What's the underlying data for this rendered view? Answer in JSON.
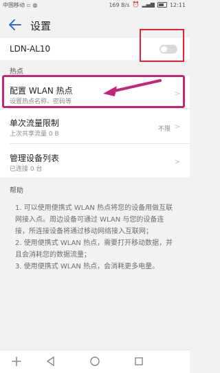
{
  "statusbar": {
    "carrier": "中国移动",
    "speed": "169 B/s",
    "battery": "33",
    "time": "12:11"
  },
  "header": {
    "title": "设置"
  },
  "device": {
    "name": "LDN-AL10",
    "toggle_on": false
  },
  "sections": {
    "hotspot_label": "热点",
    "help_label": "帮助"
  },
  "items": [
    {
      "title": "配置 WLAN 热点",
      "subtitle": "设置热点名称、密码等"
    },
    {
      "title": "单次流量限制",
      "subtitle": "上次共享流量 0 B",
      "value": "不限"
    },
    {
      "title": "管理设备列表",
      "subtitle": "已连接 0 台"
    }
  ],
  "help_text": [
    "1. 可以使用便携式 WLAN 热点将您的设备用做互联网接入点。周边设备可通过 WLAN 与您的设备连接，所连接设备将通过移动网络接入互联网；",
    "2. 使用便携式 WLAN 热点，需要打开移动数据，并且会消耗您的数据流量；",
    "3. 使用便携式 WLAN 热点，会消耗更多电量。"
  ],
  "annotation_colors": {
    "toggle_box": "#e4202e",
    "hotspot_box": "#c2267c"
  }
}
